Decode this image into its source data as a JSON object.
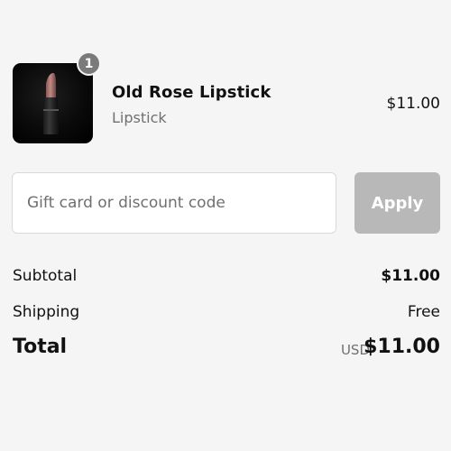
{
  "cart": {
    "item": {
      "quantity": "1",
      "name": "Old Rose Lipstick",
      "variant": "Lipstick",
      "price": "$11.00",
      "image_icon": "lipstick-product-image"
    }
  },
  "discount": {
    "placeholder": "Gift card or discount code",
    "value": "",
    "apply_label": "Apply"
  },
  "summary": {
    "subtotal_label": "Subtotal",
    "subtotal_value": "$11.00",
    "shipping_label": "Shipping",
    "shipping_value": "Free",
    "total_label": "Total",
    "currency": "USD",
    "total_value": "$11.00"
  },
  "colors": {
    "background": "#f5f5f5",
    "apply_button_disabled": "#b8b8b8",
    "badge": "#7a7a7a",
    "muted_text": "#707070"
  }
}
